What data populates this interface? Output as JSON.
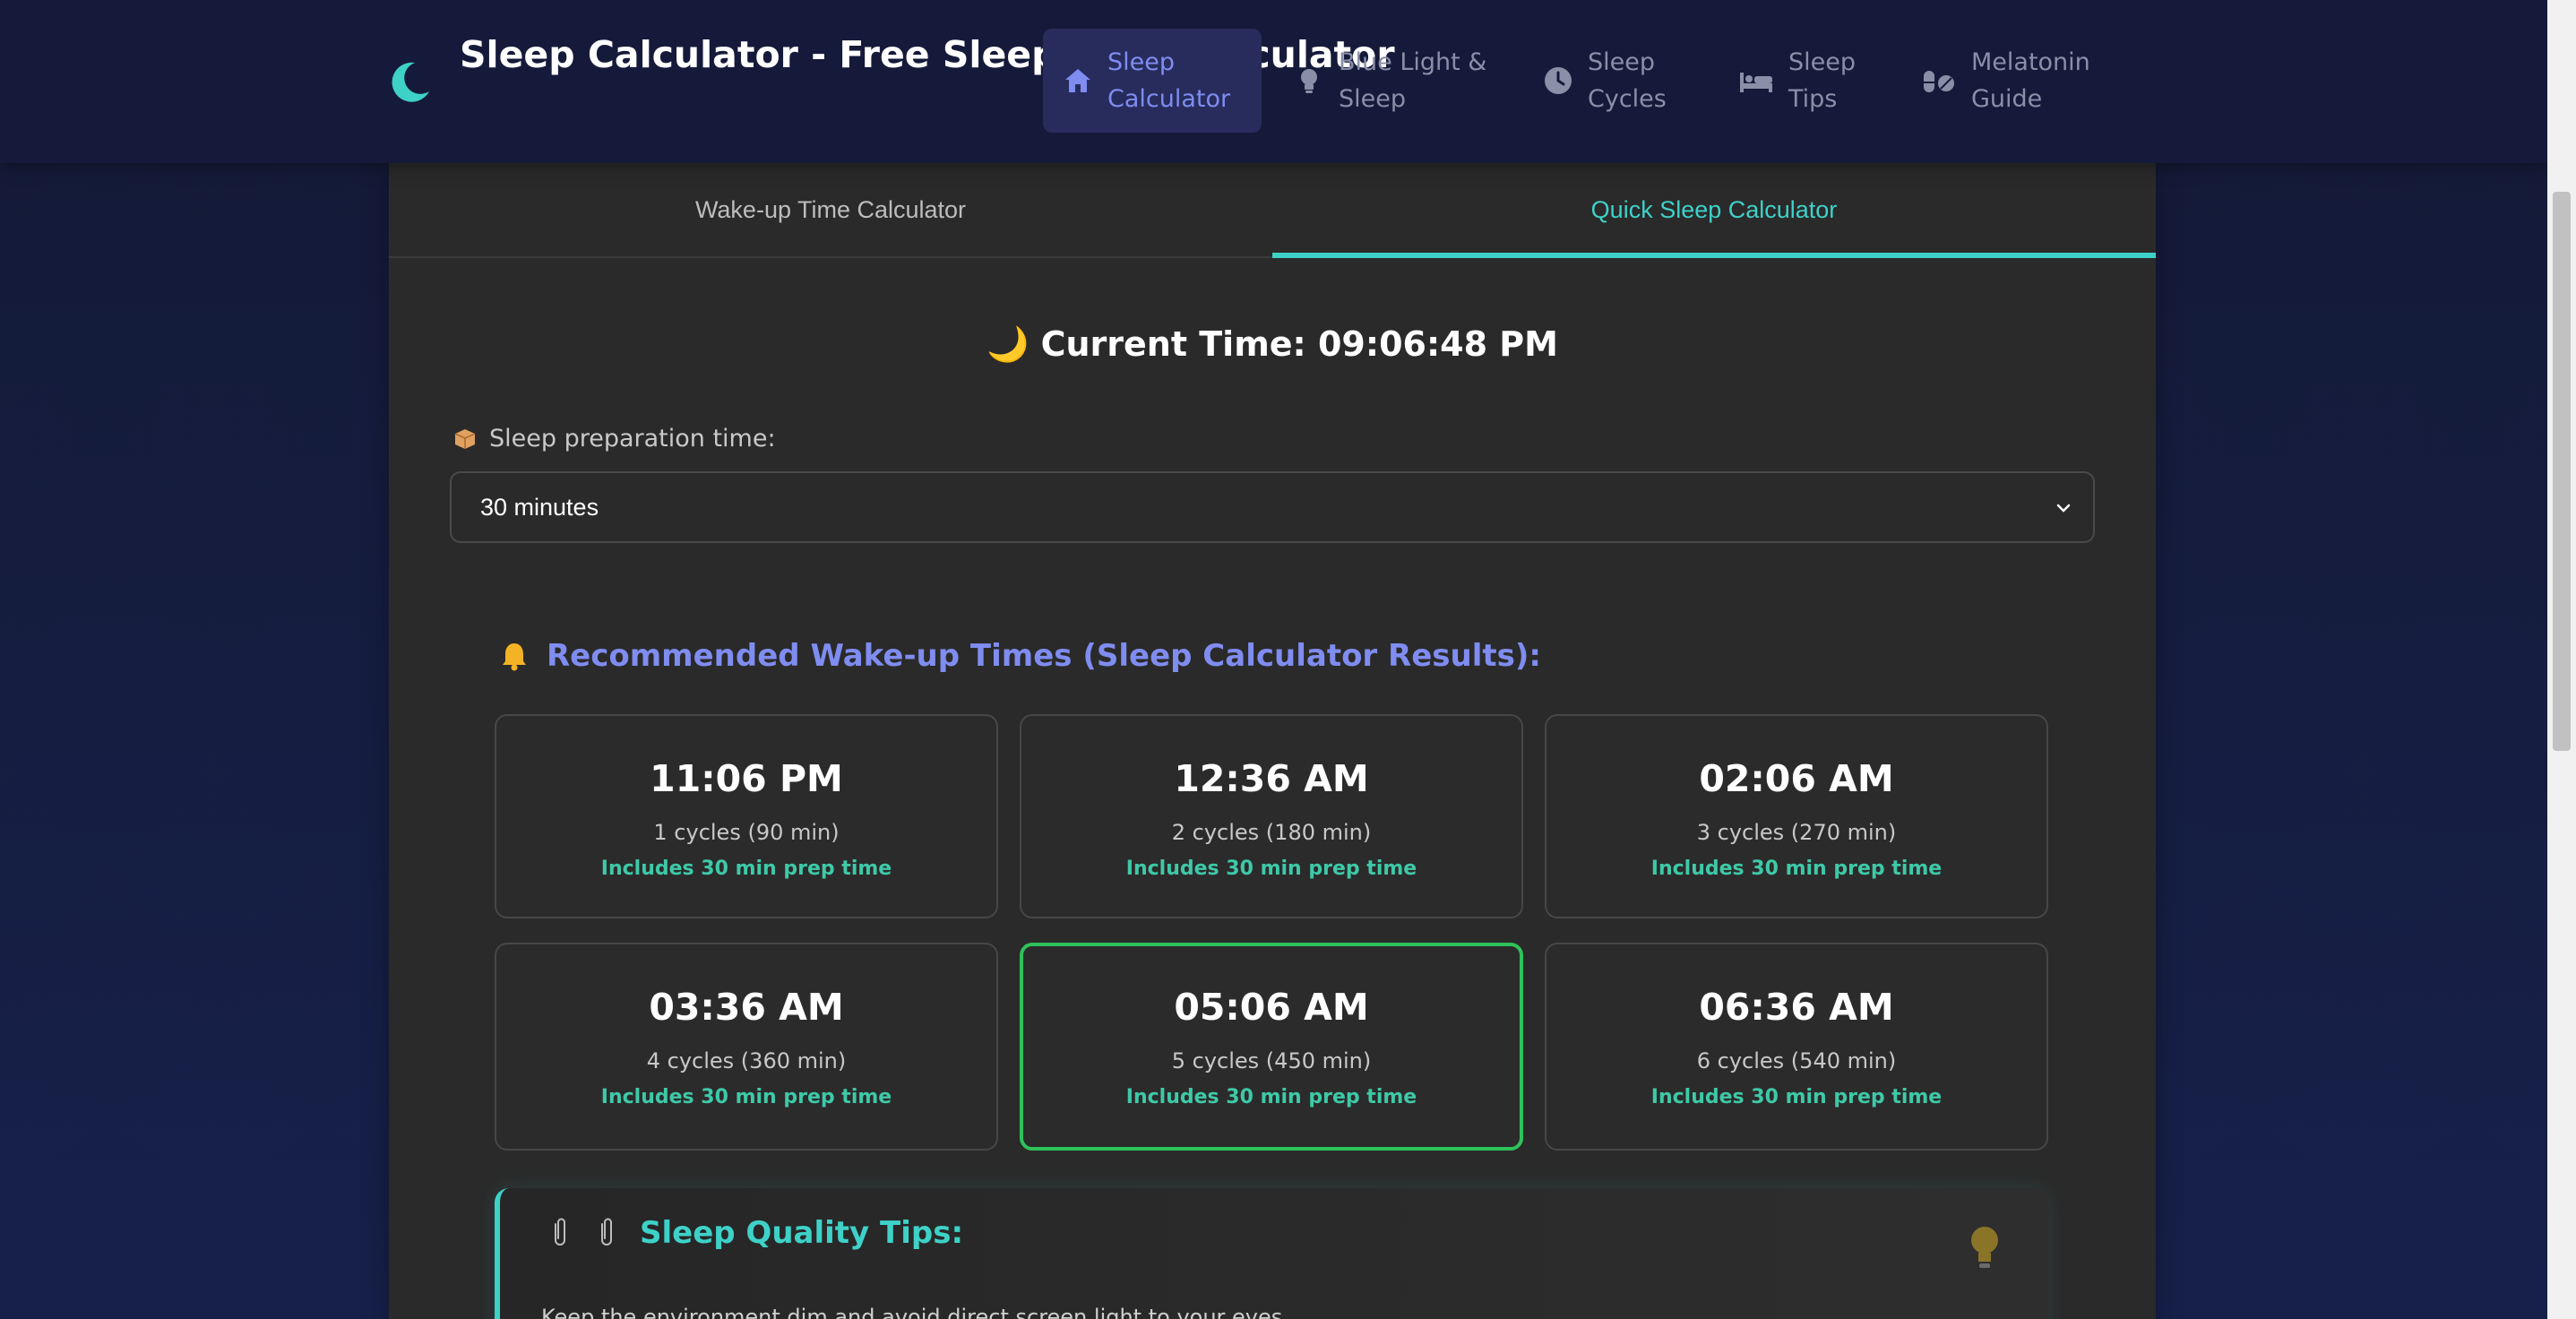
{
  "header": {
    "title": "Sleep Calculator - Free Sleep Time Calculator",
    "nav": [
      {
        "label": "Sleep Calculator",
        "icon": "home-icon",
        "active": true
      },
      {
        "label": "Blue Light & Sleep",
        "icon": "lightbulb-icon",
        "active": false
      },
      {
        "label": "Sleep Cycles",
        "icon": "clock-icon",
        "active": false
      },
      {
        "label": "Sleep Tips",
        "icon": "bed-icon",
        "active": false
      },
      {
        "label": "Melatonin Guide",
        "icon": "pills-icon",
        "active": false
      }
    ]
  },
  "tabs": [
    {
      "label": "Wake-up Time Calculator",
      "active": false
    },
    {
      "label": "Quick Sleep Calculator",
      "active": true
    }
  ],
  "current_time": "🌙 Current Time: 09:06:48 PM",
  "prep": {
    "label": "Sleep preparation time:",
    "selected": "30 minutes"
  },
  "results": {
    "title": "Recommended Wake-up Times (Sleep Calculator Results):",
    "items": [
      {
        "time": "11:06 PM",
        "cycles": "1 cycles (90 min)",
        "prep": "Includes 30 min prep time"
      },
      {
        "time": "12:36 AM",
        "cycles": "2 cycles (180 min)",
        "prep": "Includes 30 min prep time"
      },
      {
        "time": "02:06 AM",
        "cycles": "3 cycles (270 min)",
        "prep": "Includes 30 min prep time"
      },
      {
        "time": "03:36 AM",
        "cycles": "4 cycles (360 min)",
        "prep": "Includes 30 min prep time"
      },
      {
        "time": "05:06 AM",
        "cycles": "5 cycles (450 min)",
        "prep": "Includes 30 min prep time"
      },
      {
        "time": "06:36 AM",
        "cycles": "6 cycles (540 min)",
        "prep": "Includes 30 min prep time"
      }
    ]
  },
  "tips": {
    "title": "Sleep Quality Tips:",
    "text": "Keep the environment dim and avoid direct screen light to your eyes."
  },
  "colors": {
    "accent": "#3ed1c8",
    "nav_active": "#7f8cf0",
    "highlight_border": "#2ec25a",
    "prep_text": "#3ec9a7"
  }
}
